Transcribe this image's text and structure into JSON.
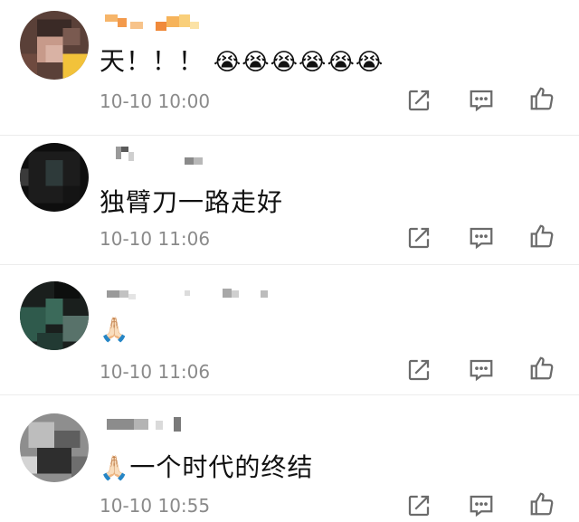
{
  "comments": [
    {
      "text": "天！！！",
      "emoji": "😭😭😭😭😭😭",
      "time": "10-10 10:00"
    },
    {
      "text": "独臂刀一路走好",
      "emoji": "",
      "time": "10-10 11:06"
    },
    {
      "text": "",
      "emoji": "🙏🏻",
      "time": "10-10 11:06"
    },
    {
      "text": "一个时代的终结",
      "emoji": "🙏🏻",
      "time": "10-10 10:55"
    }
  ],
  "icons": {
    "share": "share-icon",
    "reply": "comment-icon",
    "like": "thumbs-up-icon"
  },
  "colors": {
    "text": "#111111",
    "timestamp": "#8a8a8a",
    "icon": "#6b6b6b"
  }
}
